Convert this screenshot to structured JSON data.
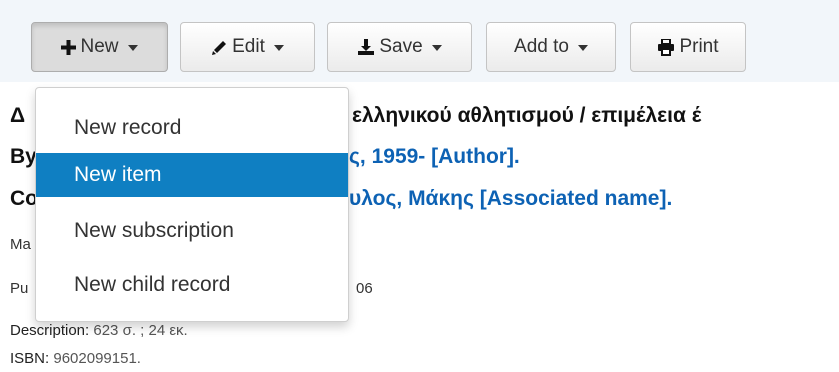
{
  "toolbar": {
    "new_label": "New",
    "edit_label": "Edit",
    "save_label": "Save",
    "addto_label": "Add to",
    "print_label": "Print"
  },
  "record": {
    "title_start": "Δ",
    "title_end": "ελληνικού αθλητισμού / επιμέλεια έ",
    "line2_prefix": "By",
    "author_link": "ς, 1959- [Author].",
    "line3_prefix": "Co",
    "assoc_link": "υλος, Μάκης [Associated name].",
    "ma_label": "Ma",
    "pu_label": "Pu",
    "pub_value": "06",
    "desc_label": "Description:",
    "desc_value": "623 σ. ; 24 εκ.",
    "isbn_label": "ISBN:",
    "isbn_value": "9602099151."
  },
  "new_menu": {
    "items": [
      {
        "label": "New record"
      },
      {
        "label": "New item"
      },
      {
        "label": "New subscription"
      },
      {
        "label": "New child record"
      }
    ],
    "highlighted": "New item"
  }
}
